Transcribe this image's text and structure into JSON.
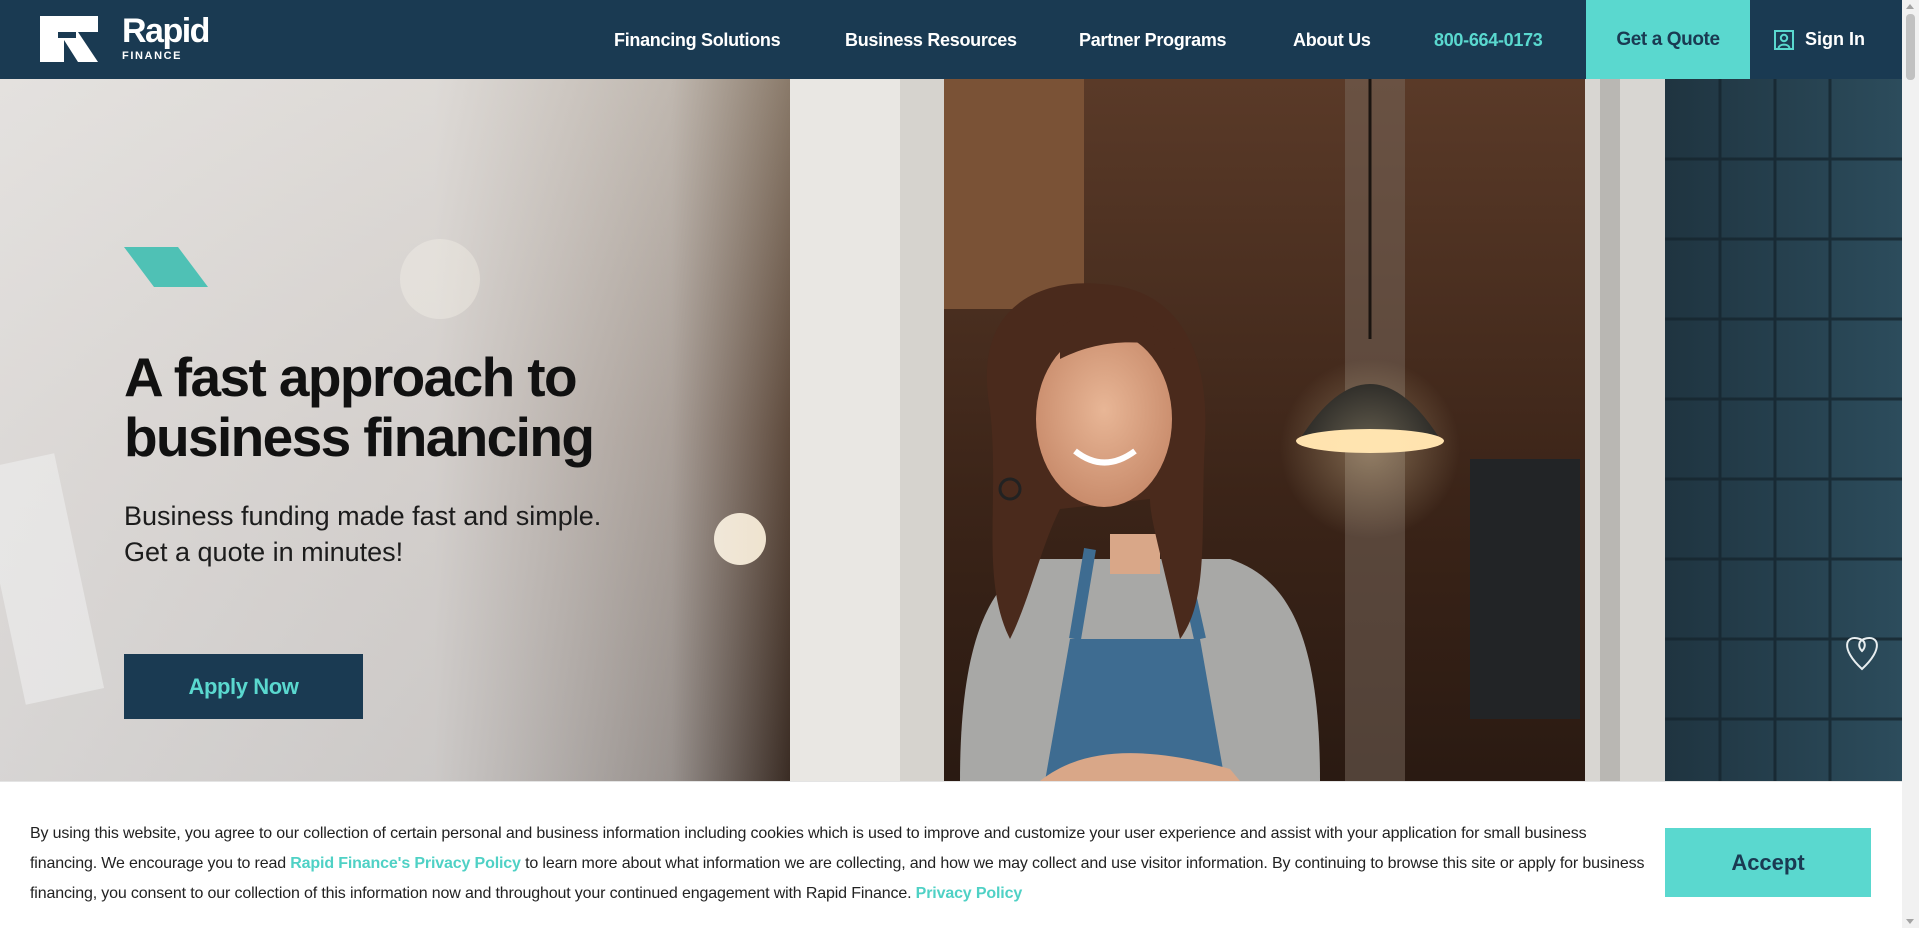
{
  "brand": {
    "name": "Rapid",
    "sub": "FINANCE",
    "logo_icon": "rapid-finance-logo-icon"
  },
  "nav": {
    "items": [
      {
        "label": "Financing Solutions"
      },
      {
        "label": "Business Resources"
      },
      {
        "label": "Partner Programs"
      },
      {
        "label": "About Us"
      }
    ],
    "phone": "800-664-0173",
    "quote_label": "Get a Quote",
    "signin_label": "Sign In",
    "signin_icon": "user-profile-icon"
  },
  "hero": {
    "title": "A fast approach to business financing",
    "subtitle_lines": [
      "Business funding made fast and simple.",
      "Get a quote in minutes!"
    ],
    "cta_label": "Apply Now",
    "image": "smiling-woman-in-apron-at-cafe-door"
  },
  "cookie_banner": {
    "text_1": "By using this website, you agree to our collection of certain personal and business information including cookies which is used to improve and customize your user experience and assist with your application for small business financing. We encourage you to read ",
    "link_1": "Rapid Finance's Privacy Policy",
    "text_2": " to learn more about what information we are collecting, and how we may collect and use visitor information. By continuing to browse this site or apply for business financing, you consent to our collection of this information now and throughout  your continued engagement with Rapid Finance. ",
    "link_2": "Privacy Policy",
    "accept_label": "Accept"
  },
  "colors": {
    "navy": "#1a3a52",
    "teal": "#5ad8cf",
    "white": "#ffffff"
  }
}
